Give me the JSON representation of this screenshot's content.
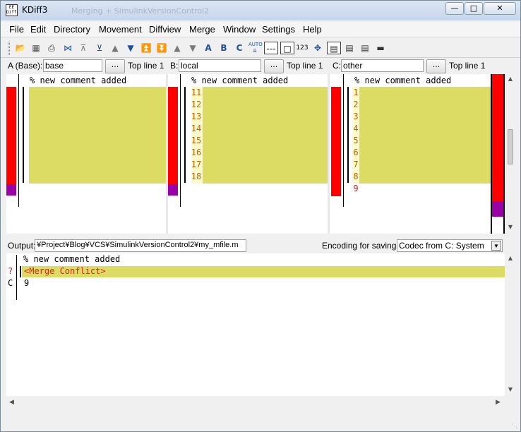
{
  "window": {
    "title": "KDiff3",
    "app_icon_top": "EE",
    "app_icon_bottom": "Diff3",
    "ghost_title": "Merging + SimulinkVersionControl2"
  },
  "menu": [
    "File",
    "Edit",
    "Directory",
    "Movement",
    "Diffview",
    "Merge",
    "Window",
    "Settings",
    "Help"
  ],
  "toolbar": {
    "auto_label": "AUTO",
    "a_label": "A",
    "b_label": "B",
    "c_label": "C",
    "n123_label": "123"
  },
  "sources": {
    "a_label": "A (Base):",
    "a_value": "base",
    "b_label": "B:",
    "b_value": "local",
    "c_label": "C:",
    "c_value": "other",
    "browse_label": "...",
    "topline_a": "Top line 1",
    "topline_b": "Top line 1",
    "topline_c": "Top line 1"
  },
  "pane_a": {
    "header": "% new comment added"
  },
  "pane_b": {
    "header": "% new comment added",
    "lines": [
      "11",
      "12",
      "13",
      "14",
      "15",
      "16",
      "17",
      "18"
    ]
  },
  "pane_c": {
    "header": "% new comment added",
    "lines": [
      "1",
      "2",
      "3",
      "4",
      "5",
      "6",
      "7",
      "8",
      "9"
    ]
  },
  "output": {
    "label": "Output:",
    "path": "¥Project¥Blog¥VCS¥SimulinkVersionControl2¥my_mfile.m",
    "encoding_label": "Encoding for saving:",
    "encoding_value": "Codec from C: System"
  },
  "merge": {
    "line1_text": "% new comment added",
    "conflict_marker": "?",
    "conflict_text": "<Merge Conflict>",
    "line3_marker": "C",
    "line3_text": "9"
  },
  "colors": {
    "changed": "#dcdc64",
    "conflict": "#ff0000",
    "deleted": "#9900a8"
  }
}
